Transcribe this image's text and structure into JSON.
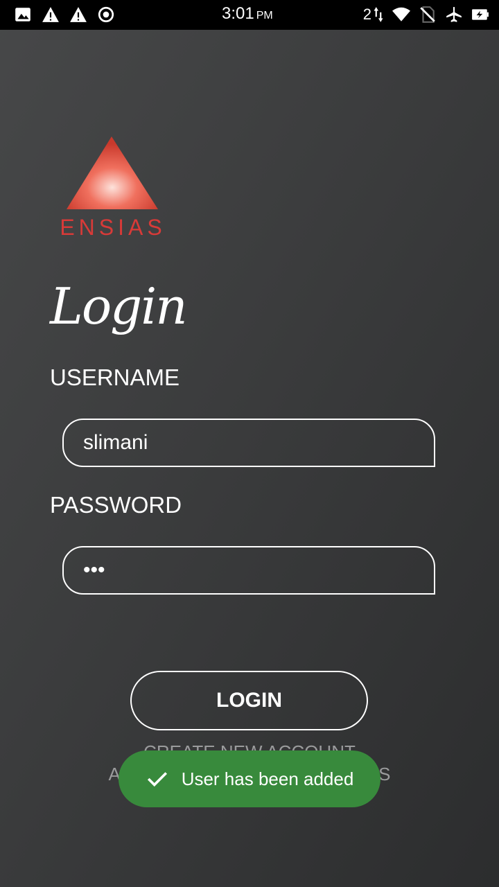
{
  "status_bar": {
    "time": "3:01",
    "ampm": "PM",
    "sim_count": "2",
    "icons_left": [
      "image-icon",
      "warning-icon",
      "warning-icon",
      "record-icon"
    ],
    "icons_right": [
      "data-arrows-icon",
      "wifi-icon",
      "no-sim-icon",
      "airplane-icon",
      "battery-icon"
    ]
  },
  "logo": {
    "text": "ENSIAS",
    "color": "#d83a38"
  },
  "screen": {
    "title": "Login"
  },
  "form": {
    "username_label": "USERNAME",
    "username_value": "slimani",
    "password_label": "PASSWORD",
    "password_value": "•••"
  },
  "actions": {
    "login_label": "LOGIN",
    "create_account_label": "CREATE NEW ACCOUNT",
    "add_info_label": "ADD INFO IN THE SAME PLACES"
  },
  "toast": {
    "message": "User has been added",
    "color": "#388a3c"
  }
}
